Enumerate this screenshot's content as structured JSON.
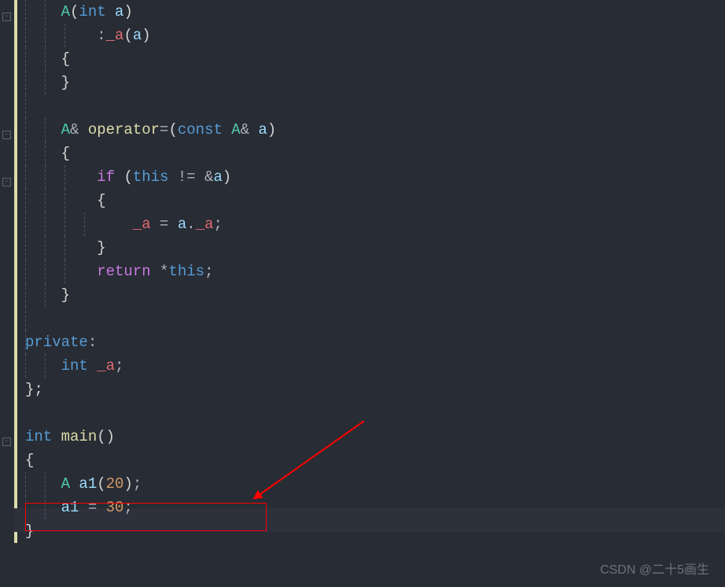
{
  "code": {
    "line1_class": "A",
    "line1_type": "int",
    "line1_param": "a",
    "line2_prefix": ":",
    "line2_member": "_a",
    "line2_arg": "a",
    "line3_brace": "{",
    "line4_brace": "}",
    "line6_class": "A",
    "line6_amp": "&",
    "line6_op": "operator",
    "line6_eq": "=",
    "line6_const": "const",
    "line6_class2": "A",
    "line6_amp2": "&",
    "line6_param": "a",
    "line7_brace": "{",
    "line8_if": "if",
    "line8_this": "this",
    "line8_neq": "!=",
    "line8_amp": "&",
    "line8_param": "a",
    "line9_brace": "{",
    "line10_member": "_a",
    "line10_eq": "=",
    "line10_obj": "a",
    "line10_dot": ".",
    "line10_member2": "_a",
    "line11_brace": "}",
    "line12_return": "return",
    "line12_star": "*",
    "line12_this": "this",
    "line13_brace": "}",
    "line15_private": "private",
    "line15_colon": ":",
    "line16_type": "int",
    "line16_member": "_a",
    "line17_brace": "};",
    "line19_type": "int",
    "line19_main": "main",
    "line19_parens": "()",
    "line20_brace": "{",
    "line21_class": "A",
    "line21_var": "a1",
    "line21_arg": "20",
    "line22_var": "a1",
    "line22_eq": "=",
    "line22_val": "30",
    "line23_brace": "}"
  },
  "watermark": "CSDN @二十5画生"
}
